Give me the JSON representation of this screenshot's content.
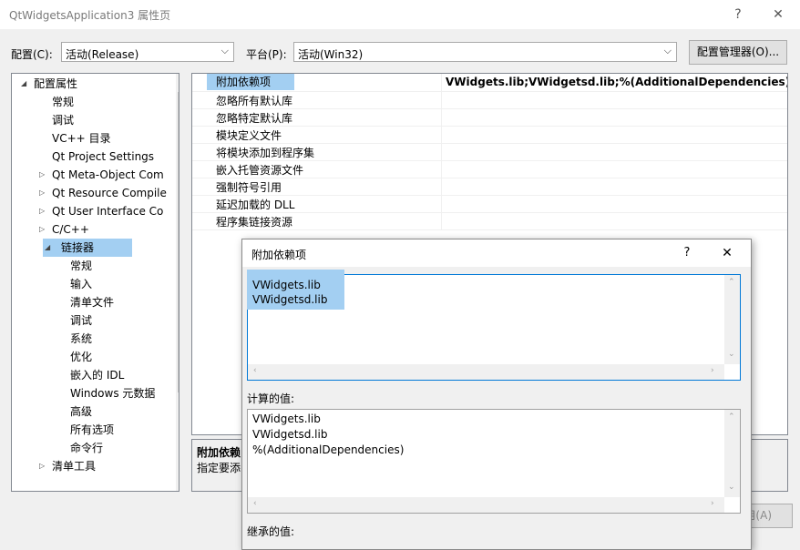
{
  "window": {
    "title": "QtWidgetsApplication3 属性页",
    "help_glyph": "?",
    "close_glyph": "✕"
  },
  "config_row": {
    "config_label": "配置(C):",
    "config_value": "活动(Release)",
    "platform_label": "平台(P):",
    "platform_value": "活动(Win32)",
    "config_manager": "配置管理器(O)..."
  },
  "tree": {
    "items": [
      {
        "label": "配置属性",
        "level": 0,
        "expander": "expanded"
      },
      {
        "label": "常规",
        "level": 1,
        "expander": "none"
      },
      {
        "label": "调试",
        "level": 1,
        "expander": "none"
      },
      {
        "label": "VC++ 目录",
        "level": 1,
        "expander": "none"
      },
      {
        "label": "Qt Project Settings",
        "level": 1,
        "expander": "none"
      },
      {
        "label": "Qt Meta-Object Com",
        "level": 1,
        "expander": "collapsed"
      },
      {
        "label": "Qt Resource Compile",
        "level": 1,
        "expander": "collapsed"
      },
      {
        "label": "Qt User Interface Co",
        "level": 1,
        "expander": "collapsed"
      },
      {
        "label": "C/C++",
        "level": 1,
        "expander": "collapsed"
      },
      {
        "label": "链接器",
        "level": 1,
        "expander": "expanded",
        "selected": true
      },
      {
        "label": "常规",
        "level": 2,
        "expander": "none"
      },
      {
        "label": "输入",
        "level": 2,
        "expander": "none"
      },
      {
        "label": "清单文件",
        "level": 2,
        "expander": "none"
      },
      {
        "label": "调试",
        "level": 2,
        "expander": "none"
      },
      {
        "label": "系统",
        "level": 2,
        "expander": "none"
      },
      {
        "label": "优化",
        "level": 2,
        "expander": "none"
      },
      {
        "label": "嵌入的 IDL",
        "level": 2,
        "expander": "none"
      },
      {
        "label": "Windows 元数据",
        "level": 2,
        "expander": "none"
      },
      {
        "label": "高级",
        "level": 2,
        "expander": "none"
      },
      {
        "label": "所有选项",
        "level": 2,
        "expander": "none"
      },
      {
        "label": "命令行",
        "level": 2,
        "expander": "none"
      },
      {
        "label": "清单工具",
        "level": 1,
        "expander": "collapsed"
      }
    ]
  },
  "grid": {
    "rows": [
      {
        "name": "附加依赖项",
        "value": "VWidgets.lib;VWidgetsd.lib;%(AdditionalDependencies)",
        "selected": true
      },
      {
        "name": "忽略所有默认库",
        "value": ""
      },
      {
        "name": "忽略特定默认库",
        "value": ""
      },
      {
        "name": "模块定义文件",
        "value": ""
      },
      {
        "name": "将模块添加到程序集",
        "value": ""
      },
      {
        "name": "嵌入托管资源文件",
        "value": ""
      },
      {
        "name": "强制符号引用",
        "value": ""
      },
      {
        "name": "延迟加载的 DLL",
        "value": ""
      },
      {
        "name": "程序集链接资源",
        "value": ""
      }
    ]
  },
  "description": {
    "title": "附加依赖",
    "text": "指定要添"
  },
  "apply_button": "用(A)",
  "dialog": {
    "title": "附加依赖项",
    "help_glyph": "?",
    "close_glyph": "✕",
    "edit_lines": [
      "VWidgets.lib",
      "VWidgetsd.lib"
    ],
    "computed_label": "计算的值:",
    "computed_lines": [
      "VWidgets.lib",
      "VWidgetsd.lib",
      "%(AdditionalDependencies)"
    ],
    "inherited_label": "继承的值:"
  },
  "colors": {
    "selection": "#a3cff2",
    "focus_border": "#0078d7"
  }
}
